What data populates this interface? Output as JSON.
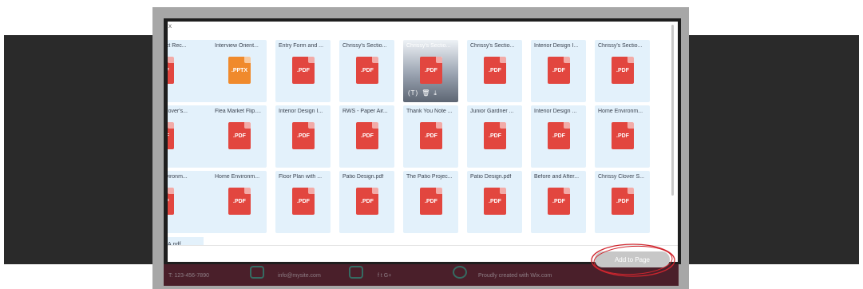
{
  "footer": {
    "phone": "T: 123-456-7890",
    "email": "info@mysite.com",
    "social": "f  t  G+",
    "credit": "Proudly created with Wix.com"
  },
  "dialog": {
    "corner_mark": "x",
    "partial_tile_name": "A.pdf",
    "add_button_label": "Add to Page",
    "selected_actions": [
      "(T)",
      "trash-icon",
      "download-icon"
    ],
    "selected_action_glyphs": [
      "(T)",
      "🗑",
      "⤓"
    ],
    "files": [
      [
        {
          "name": "ect Rec...",
          "ext": ".PDF",
          "clipped": true
        },
        {
          "name": "Interview Orient...",
          "ext": ".PPTX"
        },
        {
          "name": "Entry Form and ...",
          "ext": ".PDF"
        },
        {
          "name": "Chrissy's Sectio...",
          "ext": ".PDF"
        },
        {
          "name": "Chrissy's Sectio...",
          "ext": ".PDF",
          "selected": true
        },
        {
          "name": "Chrissy's Sectio...",
          "ext": ".PDF"
        },
        {
          "name": "Interior Design I...",
          "ext": ".PDF"
        },
        {
          "name": "Chrissy's Sectio...",
          "ext": ".PDF"
        }
      ],
      [
        {
          "name": "Clover's...",
          "ext": ".PDF",
          "clipped": true
        },
        {
          "name": "Flea Market Flip....",
          "ext": ".PDF"
        },
        {
          "name": "Interior Design I...",
          "ext": ".PDF"
        },
        {
          "name": "RWS - Paper Air...",
          "ext": ".PDF"
        },
        {
          "name": "Thank You Note ...",
          "ext": ".PDF"
        },
        {
          "name": "Junior Gardner ...",
          "ext": ".PDF"
        },
        {
          "name": "Interior Design ...",
          "ext": ".PDF"
        },
        {
          "name": "Home Environm...",
          "ext": ".PDF"
        }
      ],
      [
        {
          "name": "nvironm...",
          "ext": ".PDF",
          "clipped": true
        },
        {
          "name": "Home Environm...",
          "ext": ".PDF"
        },
        {
          "name": "Floor Plan with ...",
          "ext": ".PDF"
        },
        {
          "name": "Patio Design.pdf",
          "ext": ".PDF"
        },
        {
          "name": "The Patio Projec...",
          "ext": ".PDF"
        },
        {
          "name": "Patio Design.pdf",
          "ext": ".PDF"
        },
        {
          "name": "Before and After...",
          "ext": ".PDF"
        },
        {
          "name": "Chrissy Clover S...",
          "ext": ".PDF"
        }
      ]
    ]
  },
  "colors": {
    "pdf": "#e2463f",
    "pptx": "#f08a2c",
    "tile_bg": "#e3f1fb",
    "highlight": "#d0262e"
  }
}
